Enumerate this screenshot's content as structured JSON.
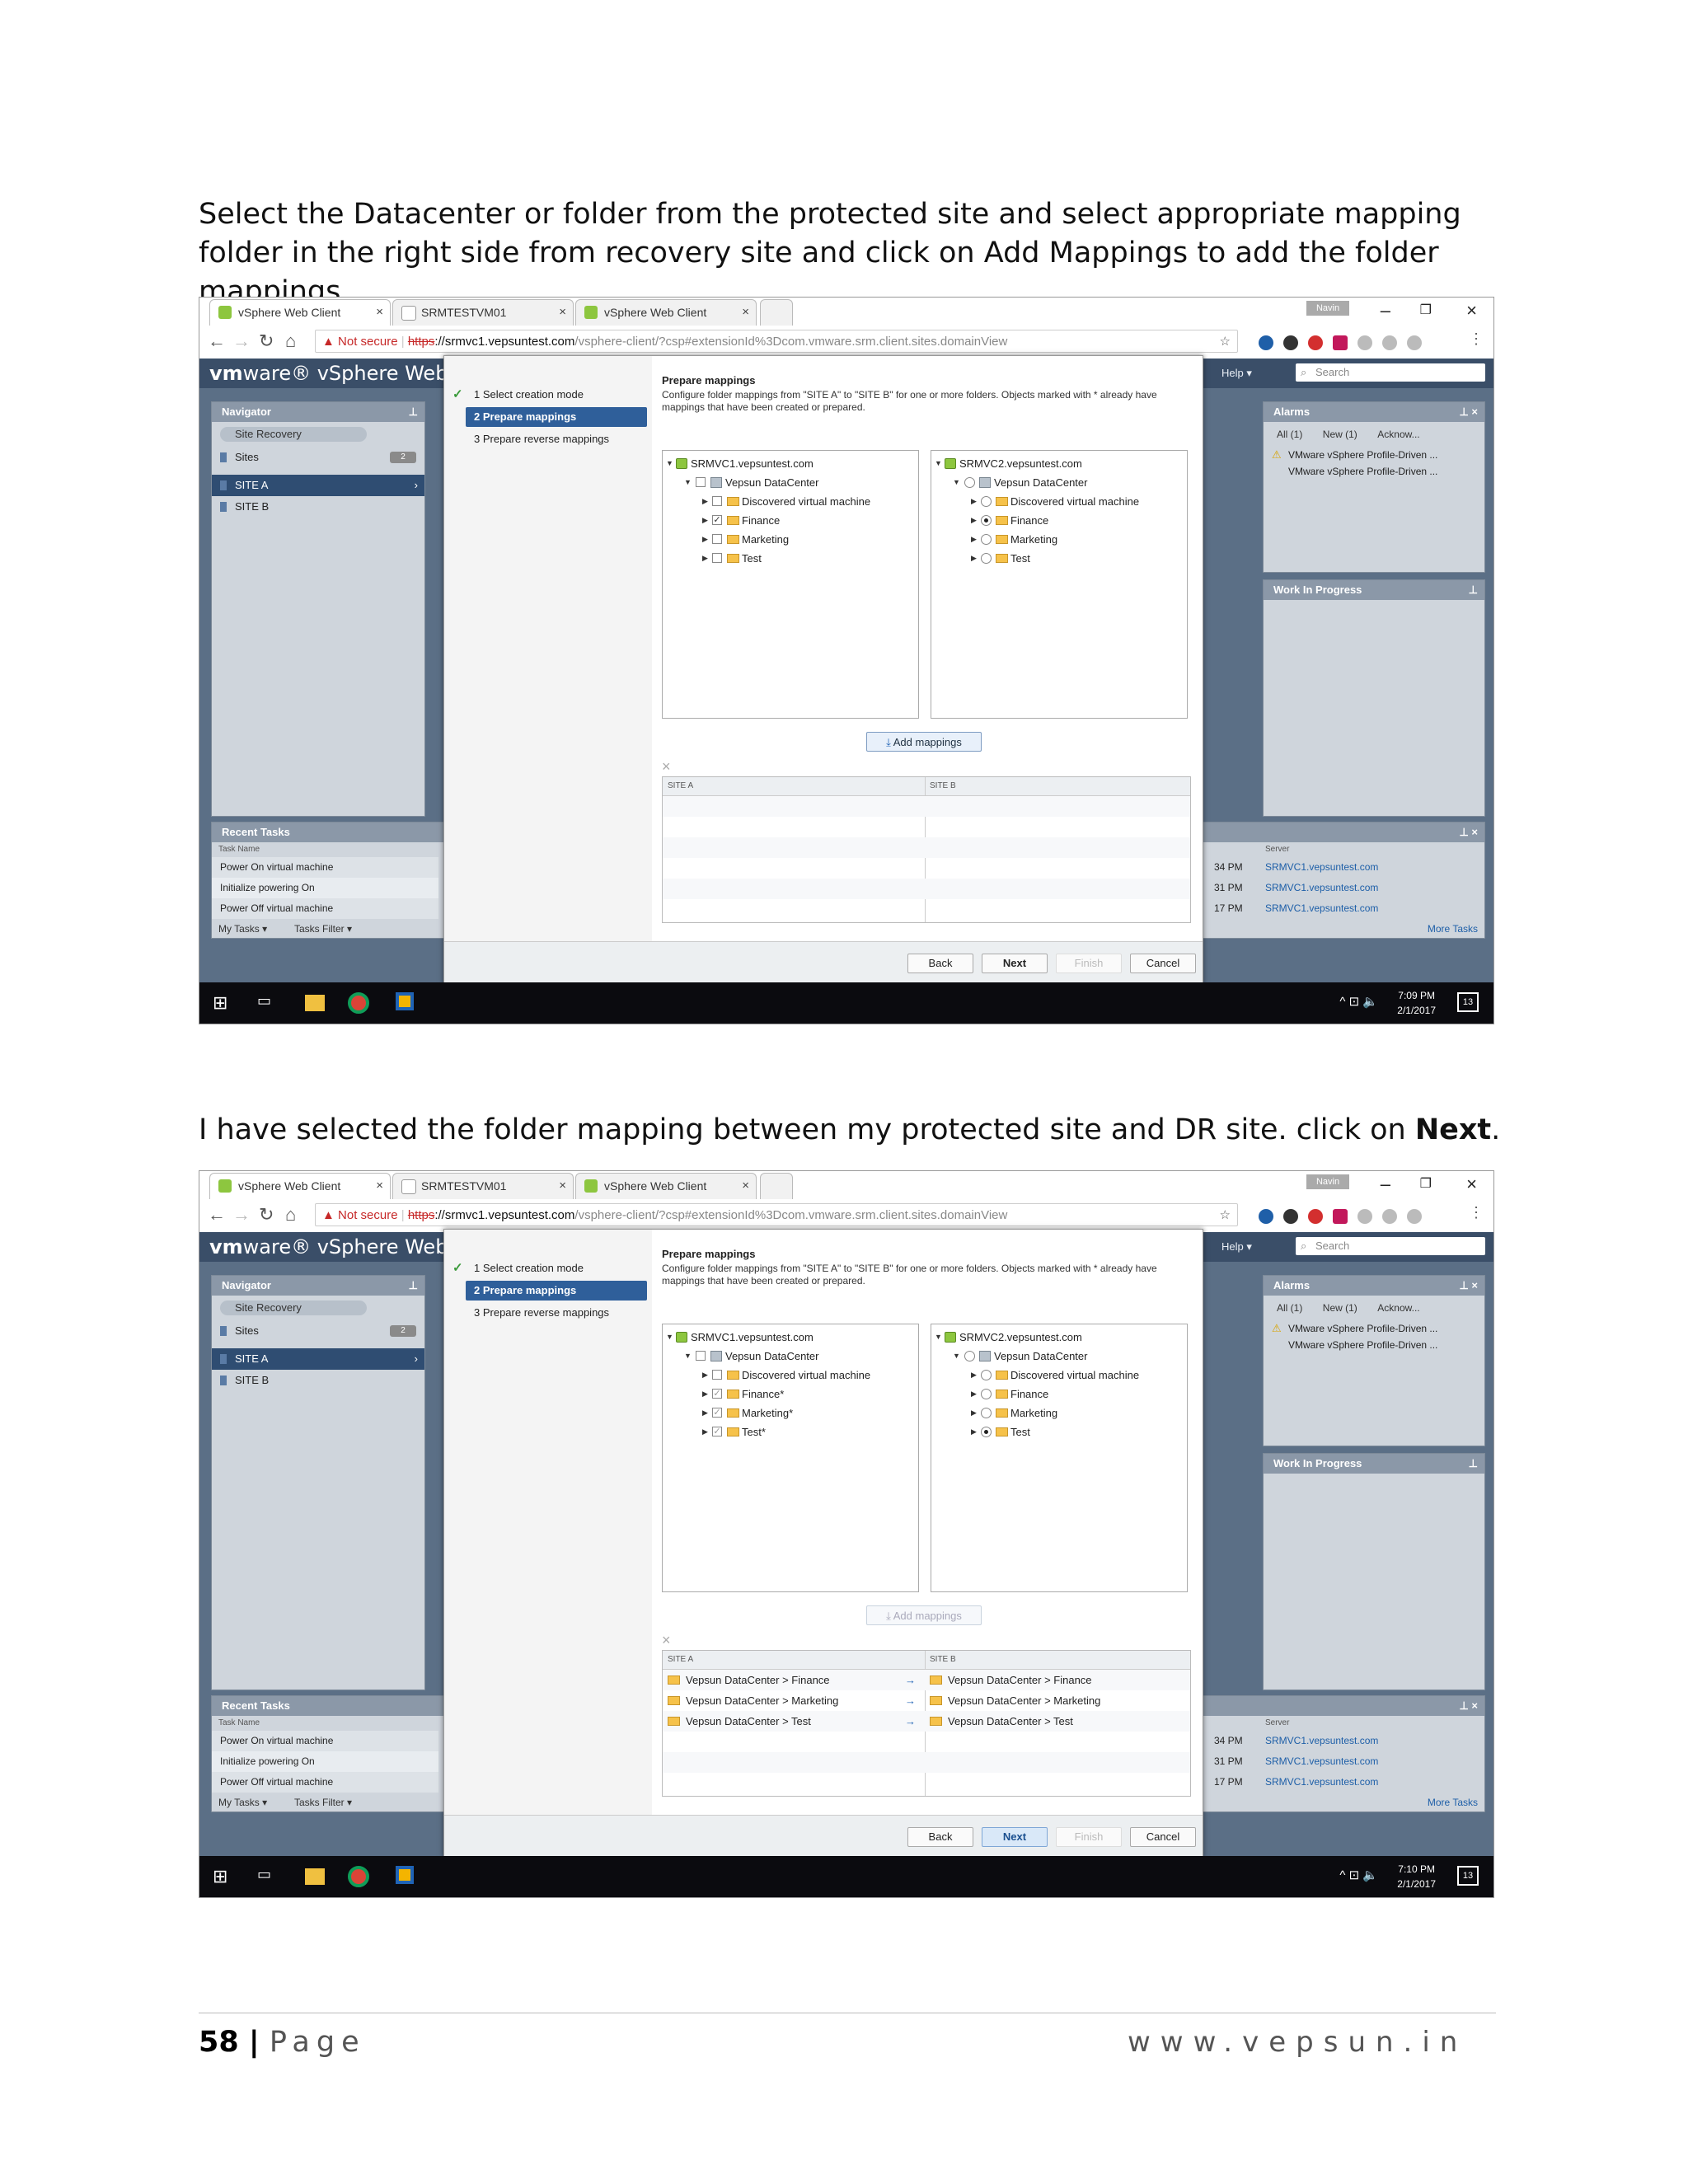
{
  "para1": "Select the Datacenter or folder from the protected site and select appropriate mapping folder in the right side from recovery site and click on Add Mappings to add the folder mappings.",
  "para2_prefix": "I have selected the folder mapping between my protected site and DR site. click on ",
  "para2_bold": "Next",
  "para2_suffix": ".",
  "browser": {
    "tabs": [
      "vSphere Web Client",
      "SRMTESTVM01",
      "vSphere Web Client"
    ],
    "user_badge": "Navin",
    "not_secure": "Not secure",
    "scheme": "https",
    "host": "://srmvc1.vepsuntest.com",
    "path": "/vsphere-client/?csp#extensionId%3Dcom.vmware.srm.client.sites.domainView"
  },
  "vsphere": {
    "brand_vm": "vm",
    "brand_rest": "ware® vSphere Web Clien",
    "help": "Help ▾",
    "search": "Search",
    "navigator": "Navigator",
    "crumb": "Site Recovery",
    "sites": "Sites",
    "sites_count": "2",
    "site_a": "SITE A",
    "site_b": "SITE B",
    "alarms": "Alarms",
    "alarm_tabs": [
      "All (1)",
      "New (1)",
      "Acknow..."
    ],
    "alarm_items": [
      "VMware vSphere Profile-Driven ...",
      "VMware vSphere Profile-Driven ..."
    ],
    "wip": "Work In Progress",
    "recent_tasks": "Recent Tasks",
    "task_name_hdr": "Task Name",
    "server_hdr": "Server",
    "tasks": [
      "Power On virtual machine",
      "Initialize powering On",
      "Power Off virtual machine"
    ],
    "task_times": [
      "34 PM",
      "31 PM",
      "17 PM"
    ],
    "task_servers": [
      "SRMVC1.vepsuntest.com",
      "SRMVC1.vepsuntest.com",
      "SRMVC1.vepsuntest.com"
    ],
    "my_tasks": "My Tasks ▾",
    "tasks_filter": "Tasks Filter ▾",
    "more_tasks": "More Tasks"
  },
  "wizard": {
    "steps": [
      "1  Select creation mode",
      "2  Prepare mappings",
      "3  Prepare reverse mappings"
    ],
    "title": "Prepare mappings",
    "desc": "Configure folder mappings from \"SITE A\" to \"SITE B\" for one or more folders. Objects marked with * already have mappings that have been created or prepared.",
    "left_vc": "SRMVC1.vepsuntest.com",
    "right_vc": "SRMVC2.vepsuntest.com",
    "datacenter": "Vepsun DataCenter",
    "folders": [
      "Discovered virtual machine",
      "Finance",
      "Marketing",
      "Test"
    ],
    "folders_mapped": [
      "Discovered virtual machine",
      "Finance*",
      "Marketing*",
      "Test*"
    ],
    "add_mappings": "Add mappings",
    "col_a": "SITE A",
    "col_b": "SITE B",
    "mappings": [
      {
        "a": "Vepsun DataCenter > Finance",
        "b": "Vepsun DataCenter > Finance"
      },
      {
        "a": "Vepsun DataCenter > Marketing",
        "b": "Vepsun DataCenter > Marketing"
      },
      {
        "a": "Vepsun DataCenter > Test",
        "b": "Vepsun DataCenter > Test"
      }
    ],
    "back": "Back",
    "next": "Next",
    "finish": "Finish",
    "cancel": "Cancel"
  },
  "taskbar": {
    "time1": "7:09 PM",
    "time2": "7:10 PM",
    "date": "2/1/2017",
    "notif": "13"
  },
  "footer": {
    "page_number": "58",
    "separator": "|",
    "page_word": "Page",
    "site": "www.vepsun.in"
  }
}
